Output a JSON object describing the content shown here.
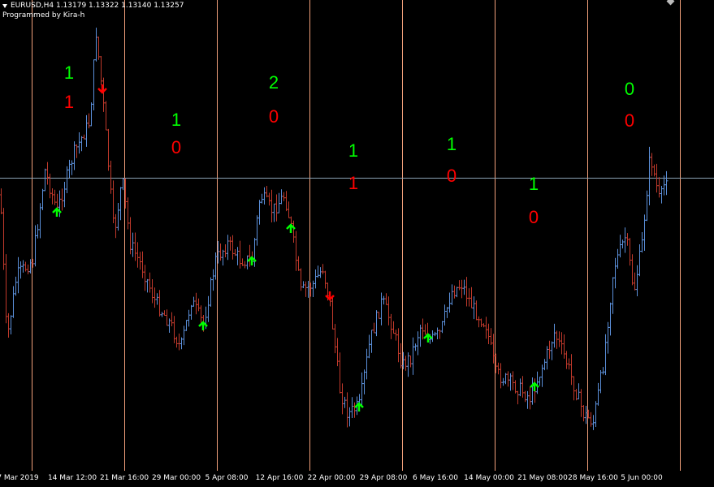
{
  "header": {
    "symbol_line": "EURUSD,H4  1.13179 1.13322 1.13140 1.13257",
    "credit": "Programmed by Kira-h"
  },
  "colors": {
    "background": "#000000",
    "bull_bar": "#5b8fd9",
    "bear_bar": "#c0392b",
    "separator": "#f2a07b",
    "bid_line": "#8ca3b5",
    "up_arrow": "#00ff00",
    "down_arrow": "#ff0000",
    "count_up": "#00ff00",
    "count_down": "#ff0000"
  },
  "time_axis": {
    "labels": [
      "7 Mar 2019",
      "14 Mar 12:00",
      "21 Mar 16:00",
      "29 Mar 00:00",
      "5 Apr 08:00",
      "12 Apr 16:00",
      "22 Apr 00:00",
      "29 Apr 08:00",
      "6 May 16:00",
      "14 May 00:00",
      "21 May 08:00",
      "28 May 16:00",
      "5 Jun 00:00"
    ]
  },
  "weekly_counts": [
    {
      "up": "1",
      "down": "1"
    },
    {
      "up": "1",
      "down": "0"
    },
    {
      "up": "2",
      "down": "0"
    },
    {
      "up": "1",
      "down": "1"
    },
    {
      "up": "1",
      "down": "0"
    },
    {
      "up": "1",
      "down": "0"
    },
    {
      "up": "0",
      "down": "0"
    }
  ],
  "signals": [
    {
      "dir": "up",
      "bar": 70
    },
    {
      "dir": "down",
      "bar": 126
    },
    {
      "dir": "up",
      "bar": 250
    },
    {
      "dir": "up",
      "bar": 310
    },
    {
      "dir": "up",
      "bar": 358
    },
    {
      "dir": "down",
      "bar": 406
    },
    {
      "dir": "up",
      "bar": 442
    },
    {
      "dir": "up",
      "bar": 527
    },
    {
      "dir": "up",
      "bar": 658
    }
  ]
}
